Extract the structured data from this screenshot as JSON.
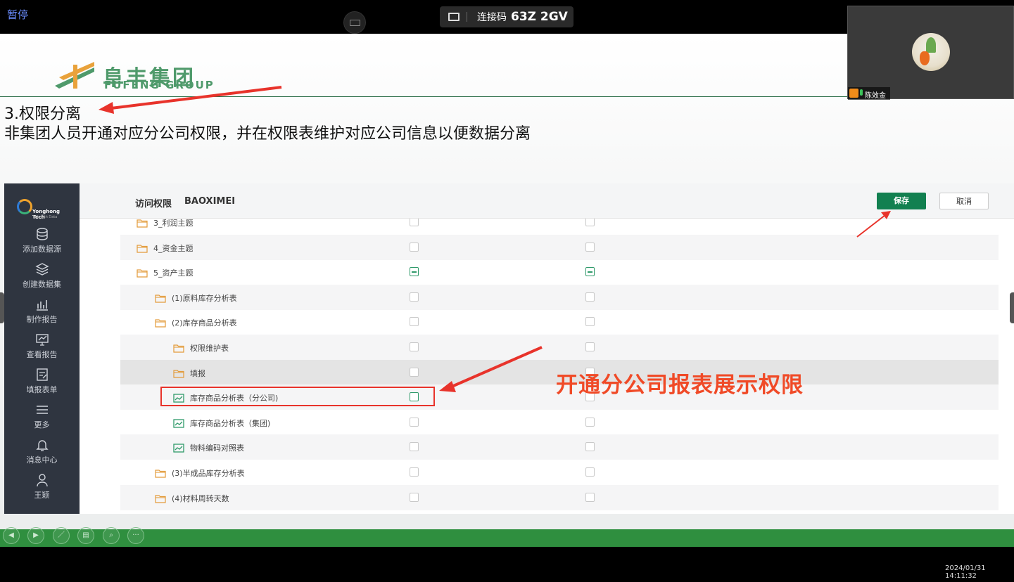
{
  "meeting": {
    "pause_label": "暂停",
    "connection_label": "连接码",
    "connection_code": "63Z 2GV",
    "timestamp": "2024/01/31 14:11:32",
    "participant_name": "陈效金"
  },
  "slide": {
    "logo_cn": "阜丰集团",
    "logo_en": "FUFENG GROUP",
    "heading": "3.权限分离",
    "subtext": "非集团人员开通对应分公司权限，并在权限表维护对应公司信息以便数据分离",
    "callout": "开通分公司报表展示权限"
  },
  "app": {
    "brand": "Yonghong Tech",
    "brand_tagline": "Talk with Data",
    "page_title": "访问权限",
    "user": "BAOXIMEI",
    "save_label": "保存",
    "cancel_label": "取消",
    "nav": [
      {
        "label": "添加数据源",
        "icon": "database-icon"
      },
      {
        "label": "创建数据集",
        "icon": "layers-icon"
      },
      {
        "label": "制作报告",
        "icon": "chart-icon"
      },
      {
        "label": "查看报告",
        "icon": "monitor-icon"
      },
      {
        "label": "填报表单",
        "icon": "form-icon"
      },
      {
        "label": "更多",
        "icon": "menu-icon"
      },
      {
        "label": "消息中心",
        "icon": "bell-icon"
      },
      {
        "label": "王颖",
        "icon": "user-icon"
      }
    ],
    "tree": [
      {
        "label": "3_利润主题",
        "type": "folder",
        "level": 0,
        "col1": "empty",
        "col2": "empty"
      },
      {
        "label": "4_资金主题",
        "type": "folder",
        "level": 0,
        "col1": "empty",
        "col2": "empty"
      },
      {
        "label": "5_资产主题",
        "type": "folder",
        "level": 0,
        "col1": "partial",
        "col2": "partial"
      },
      {
        "label": "(1)原料库存分析表",
        "type": "folder",
        "level": 1,
        "col1": "empty",
        "col2": "empty"
      },
      {
        "label": "(2)库存商品分析表",
        "type": "folder",
        "level": 1,
        "col1": "empty",
        "col2": "empty"
      },
      {
        "label": "权限维护表",
        "type": "folder",
        "level": 2,
        "col1": "empty",
        "col2": "empty"
      },
      {
        "label": "填报",
        "type": "folder",
        "level": 2,
        "col1": "empty",
        "col2": "empty"
      },
      {
        "label": "库存商品分析表（分公司)",
        "type": "report",
        "level": 2,
        "col1": "focus",
        "col2": "empty"
      },
      {
        "label": "库存商品分析表（集团)",
        "type": "report",
        "level": 2,
        "col1": "empty",
        "col2": "empty"
      },
      {
        "label": "物料编码对照表",
        "type": "report",
        "level": 2,
        "col1": "empty",
        "col2": "empty"
      },
      {
        "label": "(3)半成品库存分析表",
        "type": "folder",
        "level": 1,
        "col1": "empty",
        "col2": "empty"
      },
      {
        "label": "(4)材料周转天数",
        "type": "folder",
        "level": 1,
        "col1": "empty",
        "col2": "empty"
      }
    ]
  },
  "colors": {
    "accent_green": "#128050",
    "annotation_red": "#e8332b",
    "callout_orange": "#f04a27"
  }
}
